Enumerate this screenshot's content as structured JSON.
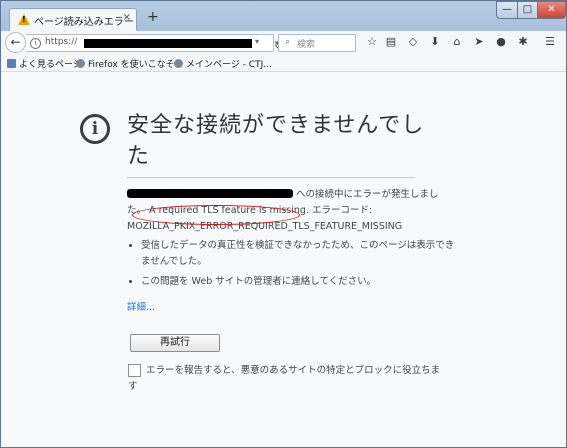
{
  "tab": {
    "title": "ページ読み込みエラー",
    "close": "×"
  },
  "newtab": "+",
  "window_controls": {
    "minimize": "—",
    "maximize": "□",
    "close": "✕"
  },
  "address": {
    "scheme": "https://",
    "dropdown": "▾",
    "reload": "↻"
  },
  "search": {
    "placeholder": "検索",
    "icon": "⌕"
  },
  "toolbar_icons": [
    {
      "name": "star-icon",
      "glyph": "☆"
    },
    {
      "name": "reading-list-icon",
      "glyph": "▤"
    },
    {
      "name": "pocket-icon",
      "glyph": "◇"
    },
    {
      "name": "download-icon",
      "glyph": "⬇"
    },
    {
      "name": "home-icon",
      "glyph": "⌂"
    },
    {
      "name": "send-icon",
      "glyph": "➤"
    },
    {
      "name": "chat-icon",
      "glyph": "●"
    },
    {
      "name": "extension-icon",
      "glyph": "✱"
    },
    {
      "name": "menu-icon",
      "glyph": "☰"
    }
  ],
  "bookmarks": [
    "よく見るページ",
    "Firefox を使いこなそう",
    "メインページ - CTJ..."
  ],
  "error": {
    "title": "安全な接続ができませんでした",
    "msg_1": "への接続中にエラーが発生しました。",
    "msg_2": "A required TLS feature is missing.",
    "msg_3": "エラーコード: MOZILLA_PKIX_ERROR_REQUIRED_TLS_FEATURE_MISSING",
    "bullet_1": "受信したデータの真正性を検証できなかったため、このページは表示できませんでした。",
    "bullet_2": "この問題を Web サイトの管理者に連絡してください。",
    "advanced": "詳細...",
    "retry": "再試行",
    "report": "エラーを報告すると、悪意のあるサイトの特定とブロックに役立ちます"
  }
}
